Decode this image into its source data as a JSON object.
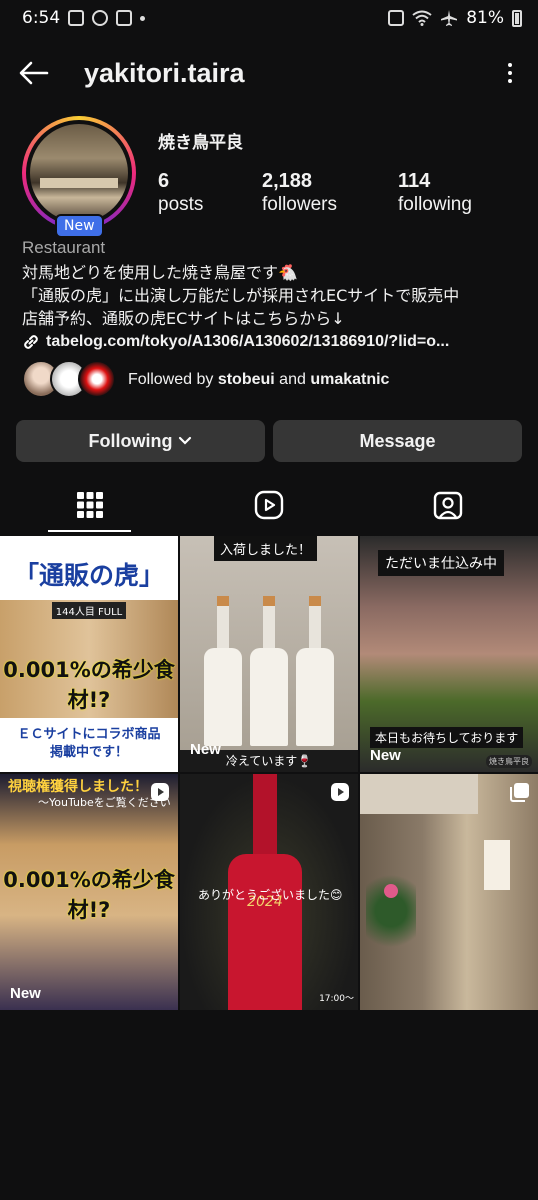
{
  "status_bar": {
    "time": "6:54",
    "battery": "81%"
  },
  "header": {
    "username": "yakitori.taira"
  },
  "profile": {
    "display_name": "焼き鳥平良",
    "new_badge": "New",
    "stats": [
      {
        "value": "6",
        "label": "posts"
      },
      {
        "value": "2,188",
        "label": "followers"
      },
      {
        "value": "114",
        "label": "following"
      }
    ],
    "category": "Restaurant",
    "bio_lines": [
      "対馬地どりを使用した焼き鳥屋です🐔",
      "「通販の虎」に出演し万能だしが採用されECサイトで販売中",
      "店舗予約、通販の虎ECサイトはこちらから↓"
    ],
    "link": "tabelog.com/tokyo/A1306/A130602/13186910/?lid=o...",
    "followed_by": {
      "prefix": "Followed by ",
      "user1": "stobeui",
      "joiner": " and ",
      "user2": "umakatnic"
    }
  },
  "buttons": {
    "following": "Following",
    "message": "Message"
  },
  "grid": {
    "post1": {
      "title": "「通販の虎」",
      "strip_top": "144人目 FULL",
      "big": "0.001%の希少食材!?",
      "line1": "ＥＣサイトにコラボ商品",
      "line2": "掲載中です！"
    },
    "post2": {
      "tag": "入荷しました！",
      "caption": "冷えています🍷",
      "new": "New"
    },
    "post3": {
      "tag": "ただいま仕込み中",
      "caption": "本日もお待ちしております",
      "logo": "焼き鳥平良",
      "new": "New"
    },
    "post4": {
      "banner": "視聴権獲得しました！",
      "yt": "〜YouTubeをご覧ください",
      "big": "0.001%の希少食材!?",
      "new": "New"
    },
    "post5": {
      "thanks": "ありがとうございました😊",
      "year": "2024",
      "time": "17:00〜"
    },
    "post6": {}
  }
}
